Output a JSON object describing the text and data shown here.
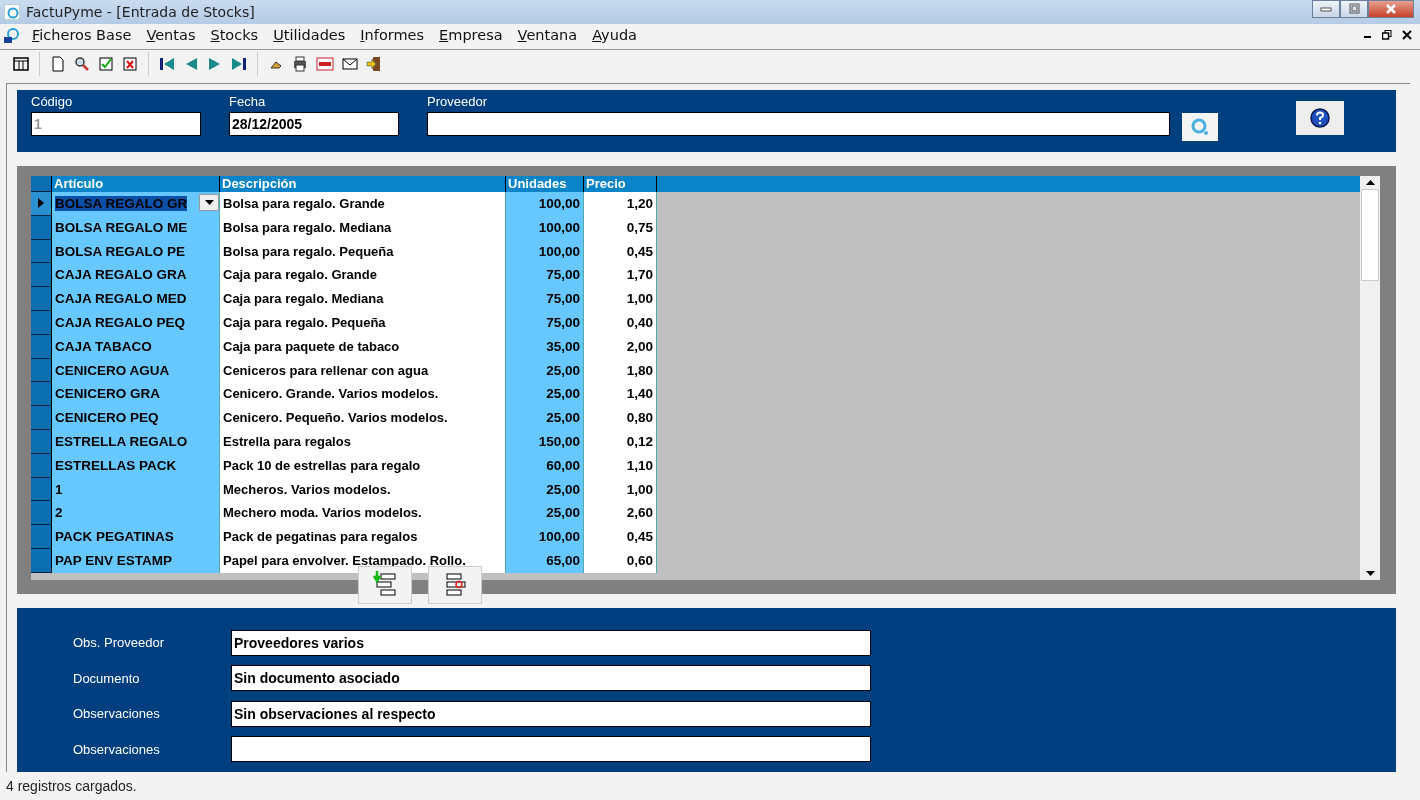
{
  "window": {
    "title": "FactuPyme - [Entrada de Stocks]"
  },
  "menu": [
    "Ficheros Base",
    "Ventas",
    "Stocks",
    "Utilidades",
    "Informes",
    "Empresa",
    "Ventana",
    "Ayuda"
  ],
  "header": {
    "fields": [
      {
        "label": "Código",
        "value": "1",
        "disabled": true,
        "kind": "short"
      },
      {
        "label": "Fecha",
        "value": "28/12/2005",
        "disabled": false,
        "kind": "short"
      },
      {
        "label": "Proveedor",
        "kind": "wide"
      }
    ]
  },
  "grid": {
    "columns": [
      "Artículo",
      "Descripción",
      "Unidades",
      "Precio"
    ],
    "rows": [
      {
        "articulo": "BOLSA REGALO GR",
        "descripcion": "Bolsa para regalo. Grande",
        "unidades": "100,00",
        "precio": "1,20",
        "selected": true
      },
      {
        "articulo": "BOLSA REGALO ME",
        "descripcion": "Bolsa para regalo. Mediana",
        "unidades": "100,00",
        "precio": "0,75",
        "selected": false
      },
      {
        "articulo": "BOLSA REGALO PE",
        "descripcion": "Bolsa para regalo. Pequeña",
        "unidades": "100,00",
        "precio": "0,45",
        "selected": false
      },
      {
        "articulo": "CAJA REGALO GRA",
        "descripcion": "Caja para regalo. Grande",
        "unidades": "75,00",
        "precio": "1,70",
        "selected": false
      },
      {
        "articulo": "CAJA REGALO MED",
        "descripcion": "Caja para regalo. Mediana",
        "unidades": "75,00",
        "precio": "1,00",
        "selected": false
      },
      {
        "articulo": "CAJA REGALO PEQ",
        "descripcion": "Caja para regalo. Pequeña",
        "unidades": "75,00",
        "precio": "0,40",
        "selected": false
      },
      {
        "articulo": "CAJA TABACO",
        "descripcion": "Caja para paquete de tabaco",
        "unidades": "35,00",
        "precio": "2,00",
        "selected": false
      },
      {
        "articulo": "CENICERO AGUA",
        "descripcion": "Ceniceros para rellenar con agua",
        "unidades": "25,00",
        "precio": "1,80",
        "selected": false
      },
      {
        "articulo": "CENICERO GRA",
        "descripcion": "Cenicero. Grande. Varios modelos.",
        "unidades": "25,00",
        "precio": "1,40",
        "selected": false
      },
      {
        "articulo": "CENICERO PEQ",
        "descripcion": "Cenicero. Pequeño. Varios modelos.",
        "unidades": "25,00",
        "precio": "0,80",
        "selected": false
      },
      {
        "articulo": "ESTRELLA REGALO",
        "descripcion": "Estrella para regalos",
        "unidades": "150,00",
        "precio": "0,12",
        "selected": false
      },
      {
        "articulo": "ESTRELLAS PACK",
        "descripcion": "Pack 10 de estrellas para regalo",
        "unidades": "60,00",
        "precio": "1,10",
        "selected": false
      },
      {
        "articulo": "1",
        "descripcion": "Mecheros. Varios modelos.",
        "unidades": "25,00",
        "precio": "1,00",
        "selected": false
      },
      {
        "articulo": "2",
        "descripcion": "Mechero moda. Varios modelos.",
        "unidades": "25,00",
        "precio": "2,60",
        "selected": false
      },
      {
        "articulo": "PACK PEGATINAS",
        "descripcion": "Pack de pegatinas para regalos",
        "unidades": "100,00",
        "precio": "0,45",
        "selected": false
      },
      {
        "articulo": "PAP ENV ESTAMP",
        "descripcion": "Papel para envolver. Estampado. Rollo.",
        "unidades": "65,00",
        "precio": "0,60",
        "selected": false
      }
    ]
  },
  "footer": {
    "fields": [
      {
        "label": "Obs. Proveedor",
        "value": "Proveedores varios"
      },
      {
        "label": "Documento",
        "value": "Sin documento asociado"
      },
      {
        "label": "Observaciones",
        "value": "Sin observaciones al respecto"
      },
      {
        "label": "Observaciones"
      }
    ]
  },
  "status_bar": "4 registros cargados."
}
